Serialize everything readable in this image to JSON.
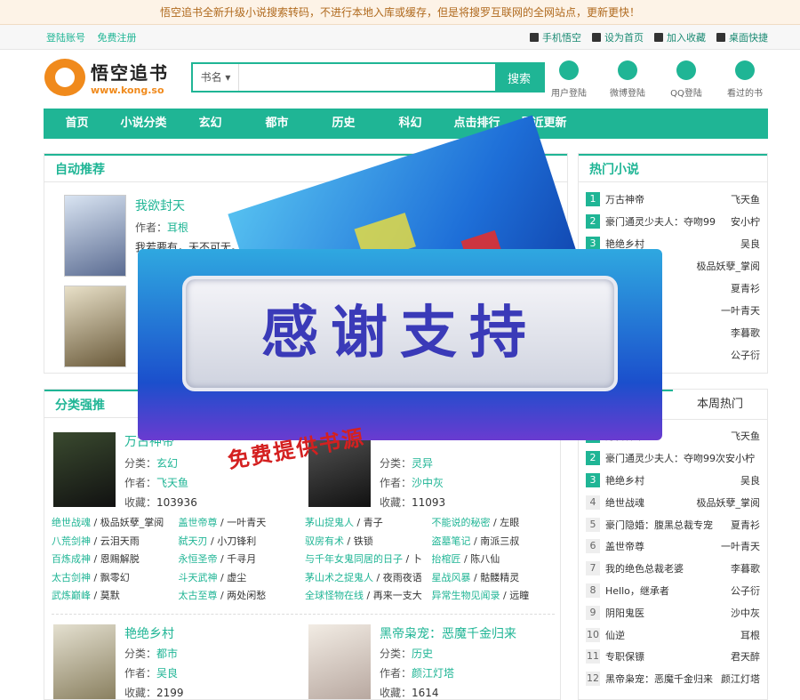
{
  "notice": "悟空追书全新升级小说搜索转码，不进行本地入库或缓存，但是将搜罗互联网的全网站点，更新更快！",
  "topbar": {
    "login": "登陆账号",
    "register": "免费注册",
    "right": [
      {
        "label": "手机悟空",
        "icon": "phone-icon"
      },
      {
        "label": "设为首页",
        "icon": "home-icon"
      },
      {
        "label": "加入收藏",
        "icon": "star-icon"
      },
      {
        "label": "桌面快捷",
        "icon": "desktop-icon"
      }
    ]
  },
  "logo": {
    "cn": "悟空追书",
    "en": "www.kong.so"
  },
  "search": {
    "select": "书名 ▾",
    "placeholder": "",
    "button": "搜索"
  },
  "quick": [
    "用户登陆",
    "微博登陆",
    "QQ登陆",
    "看过的书"
  ],
  "nav": [
    "首页",
    "小说分类",
    "玄幻",
    "都市",
    "历史",
    "科幻",
    "点击排行",
    "最近更新"
  ],
  "auto": {
    "title": "自动推荐",
    "books": [
      {
        "title": "我欲封天",
        "author_label": "作者：",
        "author": "耳根",
        "desc": "我若要有，天不可无。我若"
      }
    ]
  },
  "hot": {
    "title": "热门小说",
    "items": [
      {
        "n": "1",
        "t": "万古神帝",
        "a": "飞天鱼"
      },
      {
        "n": "2",
        "t": "豪门通灵少夫人：夺吻99",
        "a": "安小柠"
      },
      {
        "n": "3",
        "t": "艳绝乡村",
        "a": "吴良"
      },
      {
        "n": "4",
        "t": "",
        "a": "极品妖孽_掌阅"
      },
      {
        "n": "5",
        "t": "",
        "a": "夏青衫"
      },
      {
        "n": "6",
        "t": "",
        "a": "一叶青天"
      },
      {
        "n": "7",
        "t": "",
        "a": "李暮歌"
      },
      {
        "n": "8",
        "t": "",
        "a": "公子衍"
      }
    ]
  },
  "cat": {
    "title": "分类强推",
    "books": [
      {
        "title": "万古神帝",
        "cat_label": "分类：",
        "cat": "玄幻",
        "author_label": "作者：",
        "author": "飞天鱼",
        "hits_label": "收藏：",
        "hits": "103936"
      },
      {
        "title": "",
        "cat_label": "分类：",
        "cat": "灵异",
        "author_label": "作者：",
        "author": "沙中灰",
        "hits_label": "收藏：",
        "hits": "11093"
      },
      {
        "title": "艳绝乡村",
        "cat_label": "分类：",
        "cat": "都市",
        "author_label": "作者：",
        "author": "吴良",
        "hits_label": "收藏：",
        "hits": "2199"
      },
      {
        "title": "黑帝枭宠：恶魔千金归来",
        "cat_label": "分类：",
        "cat": "历史",
        "author_label": "作者：",
        "author": "颜江灯塔",
        "hits_label": "收藏：",
        "hits": "1614"
      }
    ],
    "links": [
      [
        {
          "b": "绝世战魂",
          "a": " / 极品妖孽_掌阅"
        },
        {
          "b": "盖世帝尊",
          "a": " / 一叶青天"
        },
        {
          "b": "茅山捉鬼人",
          "a": " / 青子"
        },
        {
          "b": "不能说的秘密",
          "a": " / 左眼"
        }
      ],
      [
        {
          "b": "八荒剑神",
          "a": " / 云泪天雨"
        },
        {
          "b": "弑天刃",
          "a": " / 小刀锋利"
        },
        {
          "b": "驭房有术",
          "a": " / 铁锁"
        },
        {
          "b": "盗墓笔记",
          "a": " / 南派三叔"
        }
      ],
      [
        {
          "b": "百炼成神",
          "a": " / 恩赐解脱"
        },
        {
          "b": "永恒圣帝",
          "a": " / 千寻月"
        },
        {
          "b": "与千年女鬼同居的日子",
          "a": " / 卜"
        },
        {
          "b": "抬棺匠",
          "a": " / 陈八仙"
        }
      ],
      [
        {
          "b": "太古剑神",
          "a": " / 飘零幻"
        },
        {
          "b": "斗天武神",
          "a": " / 虚尘"
        },
        {
          "b": "茅山术之捉鬼人",
          "a": " / 夜雨夜语"
        },
        {
          "b": "星战风暴",
          "a": " / 骷髅精灵"
        }
      ],
      [
        {
          "b": "武炼巅峰",
          "a": " / 莫默"
        },
        {
          "b": "太古至尊",
          "a": " / 两处闲愁"
        },
        {
          "b": "全球怪物在线",
          "a": " / 再来一支大"
        },
        {
          "b": "异常生物见闻录",
          "a": " / 远瞳"
        }
      ]
    ]
  },
  "weekly": {
    "tab_active": "",
    "tab_other": "本周热门",
    "items": [
      {
        "n": "1",
        "t": "万古神帝",
        "a": "飞天鱼"
      },
      {
        "n": "2",
        "t": "豪门通灵少夫人：夺吻99次安小柠",
        "a": ""
      },
      {
        "n": "3",
        "t": "艳绝乡村",
        "a": "吴良"
      },
      {
        "n": "4",
        "t": "绝世战魂",
        "a": "极品妖孽_掌阅"
      },
      {
        "n": "5",
        "t": "豪门隐婚：腹黑总裁专宠",
        "a": "夏青衫"
      },
      {
        "n": "6",
        "t": "盖世帝尊",
        "a": "一叶青天"
      },
      {
        "n": "7",
        "t": "我的绝色总裁老婆",
        "a": "李暮歌"
      },
      {
        "n": "8",
        "t": "Hello，继承者",
        "a": "公子衍"
      },
      {
        "n": "9",
        "t": "阴阳鬼医",
        "a": "沙中灰"
      },
      {
        "n": "10",
        "t": "仙逆",
        "a": "耳根"
      },
      {
        "n": "11",
        "t": "专职保镖",
        "a": "君天醉"
      },
      {
        "n": "12",
        "t": "黑帝枭宠：恶魔千金归来",
        "a": "颜江灯塔"
      }
    ]
  },
  "ad": {
    "main": "感谢支持",
    "tag": "免费提供书源"
  }
}
